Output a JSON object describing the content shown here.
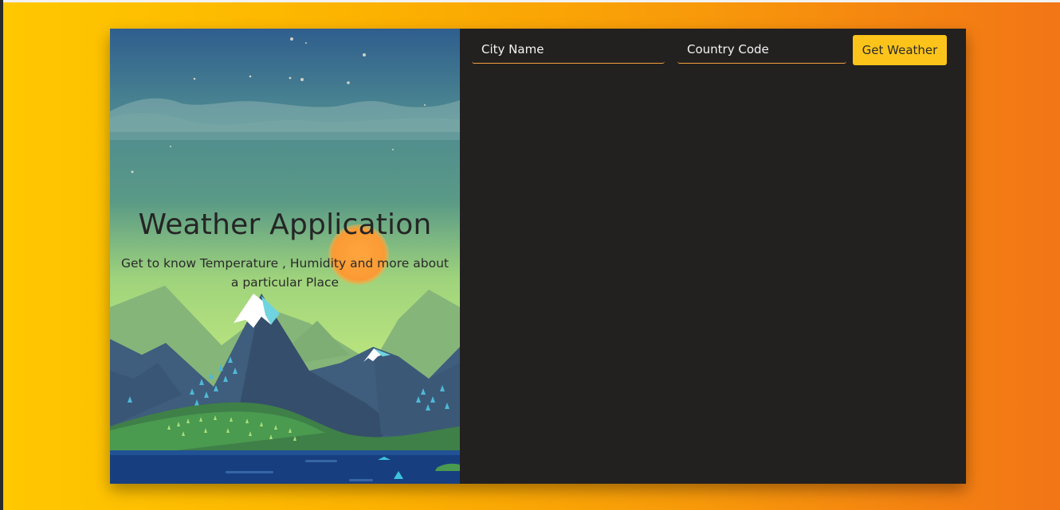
{
  "hero": {
    "title": "Weather Application",
    "subtitle": "Get to know Temperature , Humidity and more about a particular Place"
  },
  "form": {
    "city_placeholder": "City Name",
    "country_placeholder": "Country Code",
    "submit_label": "Get Weather"
  },
  "colors": {
    "gradient_start": "#ffc800",
    "gradient_end": "#f27516",
    "panel_bg": "#232020",
    "button_bg": "#fcc41a",
    "input_underline": "#f0a23a"
  }
}
